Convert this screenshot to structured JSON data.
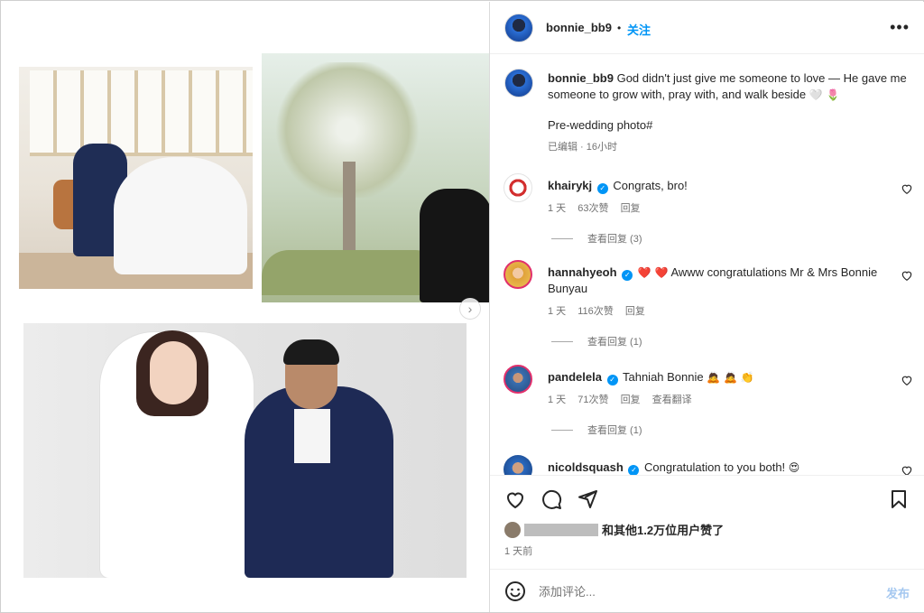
{
  "post": {
    "author": "bonnie_bb9",
    "follow_label": "关注",
    "separator": "•",
    "caption_text": "God didn't just give me someone to love — He gave me someone to grow with, pray with, and walk beside",
    "caption_emoji": "🤍 🌷",
    "caption_tag": "Pre-wedding photo#",
    "edited_meta": "已编辑 · 16小时"
  },
  "comments": [
    {
      "username": "khairykj",
      "text": "Congrats, bro!",
      "time": "1 天",
      "likes": "63次赞",
      "reply": "回复",
      "view_replies": "查看回复 (3)"
    },
    {
      "username": "hannahyeoh",
      "emoji": "❤️ ❤️",
      "text": "Awww congratulations Mr & Mrs Bonnie Bunyau",
      "time": "1 天",
      "likes": "116次赞",
      "reply": "回复",
      "view_replies": "查看回复 (1)"
    },
    {
      "username": "pandelela",
      "text": "Tahniah Bonnie",
      "emoji": "🙇 🙇 👏",
      "time": "1 天",
      "likes": "71次赞",
      "reply": "回复",
      "translate": "查看翻译",
      "view_replies": "查看回复 (1)"
    },
    {
      "username": "nicoldsquash",
      "text": "Congratulation to you both!",
      "emoji": "😍"
    }
  ],
  "actions": {
    "likes_text": "和其他1.2万位用户赞了",
    "time_ago": "1 天前"
  },
  "composer": {
    "placeholder": "添加评论...",
    "post_label": "发布"
  },
  "icons": {
    "more": "more-options-icon",
    "like": "heart-icon",
    "comment": "comment-icon",
    "share": "share-icon",
    "save": "bookmark-icon",
    "emoji": "emoji-icon",
    "next": "chevron-right-icon"
  },
  "colors": {
    "accent": "#0095f6",
    "text": "#262626",
    "muted": "#737373",
    "like_red": "#ed4956"
  }
}
